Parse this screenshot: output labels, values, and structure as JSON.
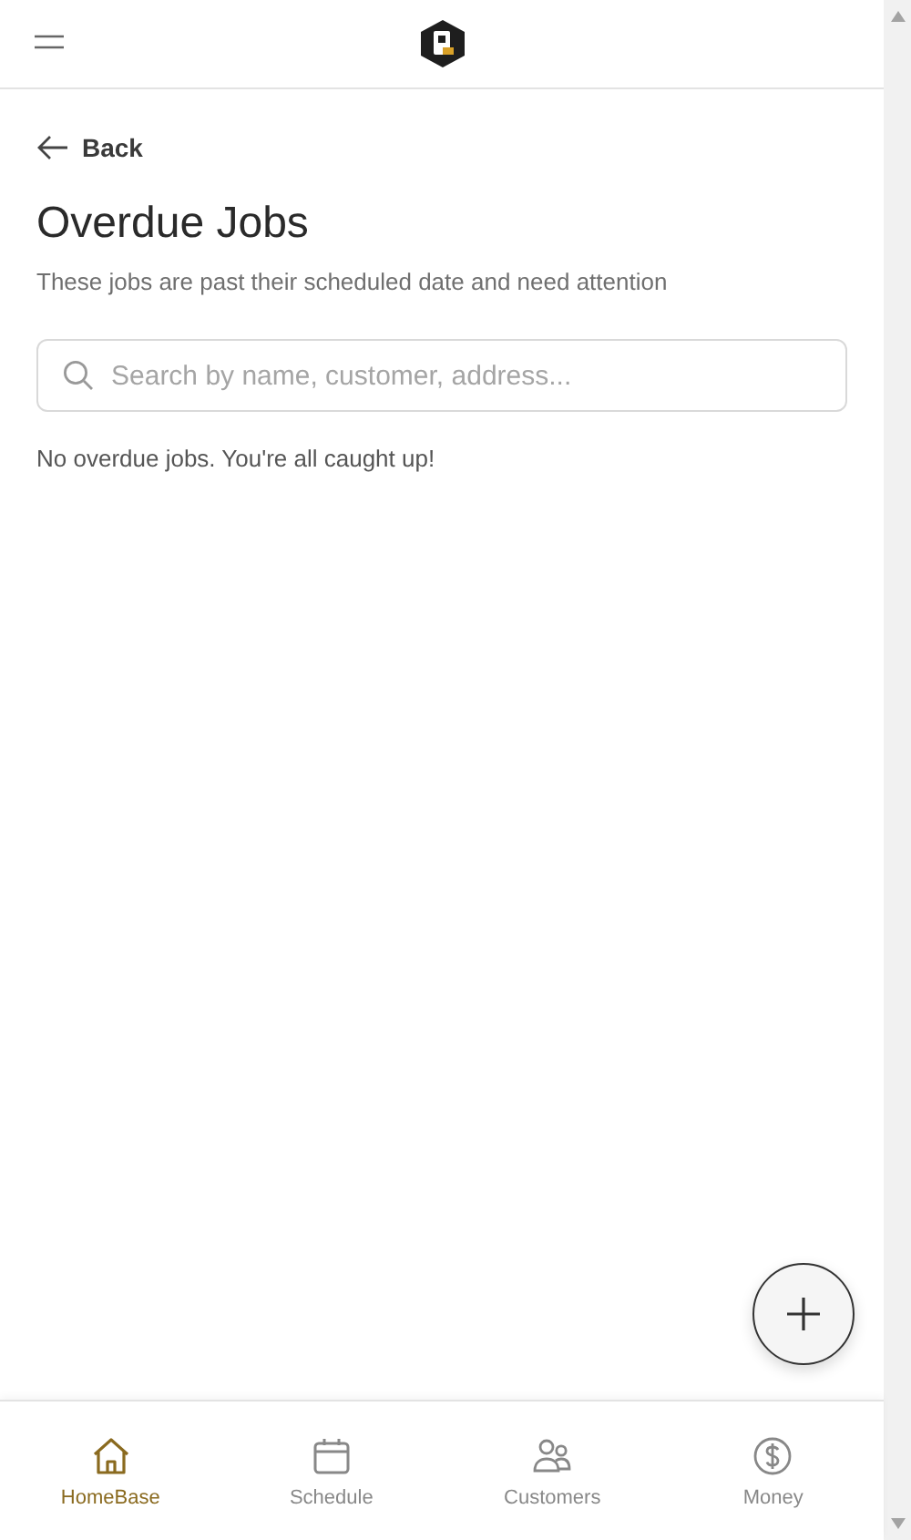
{
  "back": {
    "label": "Back"
  },
  "page": {
    "title": "Overdue Jobs",
    "subtitle": "These jobs are past their scheduled date and need attention"
  },
  "search": {
    "placeholder": "Search by name, customer, address..."
  },
  "empty_message": "No overdue jobs. You're all caught up!",
  "bottom_nav": [
    {
      "label": "HomeBase",
      "selected": true
    },
    {
      "label": "Schedule",
      "selected": false
    },
    {
      "label": "Customers",
      "selected": false
    },
    {
      "label": "Money",
      "selected": false
    }
  ]
}
